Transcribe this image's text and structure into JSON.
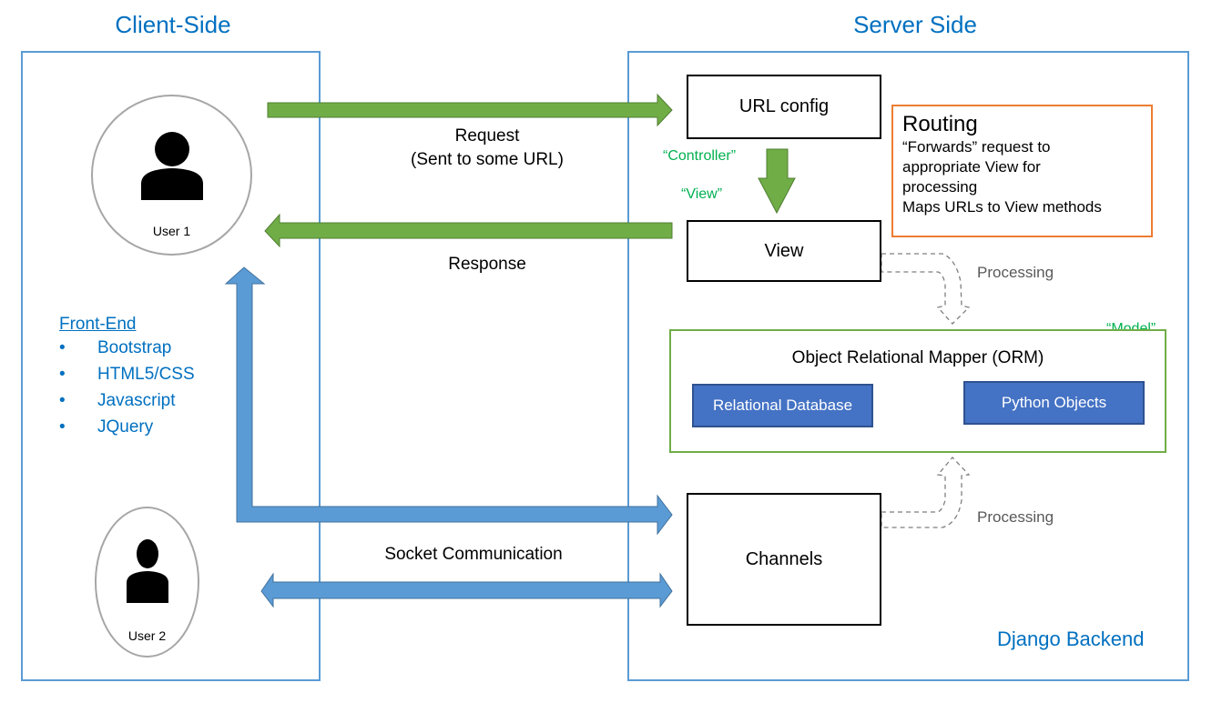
{
  "client": {
    "title": "Client-Side",
    "users": [
      {
        "label": "User 1",
        "icon": "person-icon"
      },
      {
        "label": "User 2",
        "icon": "person-icon"
      }
    ],
    "frontend": {
      "title": "Front-End",
      "items": [
        "Bootstrap",
        "HTML5/CSS",
        "Javascript",
        "JQuery"
      ]
    }
  },
  "server": {
    "title": "Server Side",
    "footer": "Django Backend",
    "url_config": "URL config",
    "view": "View",
    "channels": "Channels",
    "controller_label": "“Controller”",
    "view_label": "“View”",
    "model_label": "“Model”",
    "processing_1": "Processing",
    "processing_2": "Processing",
    "routing": {
      "title": "Routing",
      "lines": [
        "“Forwards” request to",
        "appropriate View for",
        "processing",
        "Maps URLs to View methods"
      ]
    },
    "orm": {
      "title": "Object Relational Mapper (ORM)",
      "source": "Relational Database",
      "target": "Python Objects"
    }
  },
  "flows": {
    "request": [
      "Request",
      "(Sent to some URL)"
    ],
    "response": "Response",
    "socket": "Socket Communication"
  },
  "colors": {
    "accent_blue": "#0070c0",
    "panel_border": "#5b9bd5",
    "http_arrow": "#70ad47",
    "socket_arrow": "#5b9bd5",
    "routing_border": "#ed7d31",
    "orm_border": "#70ad47",
    "db_fill": "#4472c4",
    "label_green": "#00b050"
  }
}
